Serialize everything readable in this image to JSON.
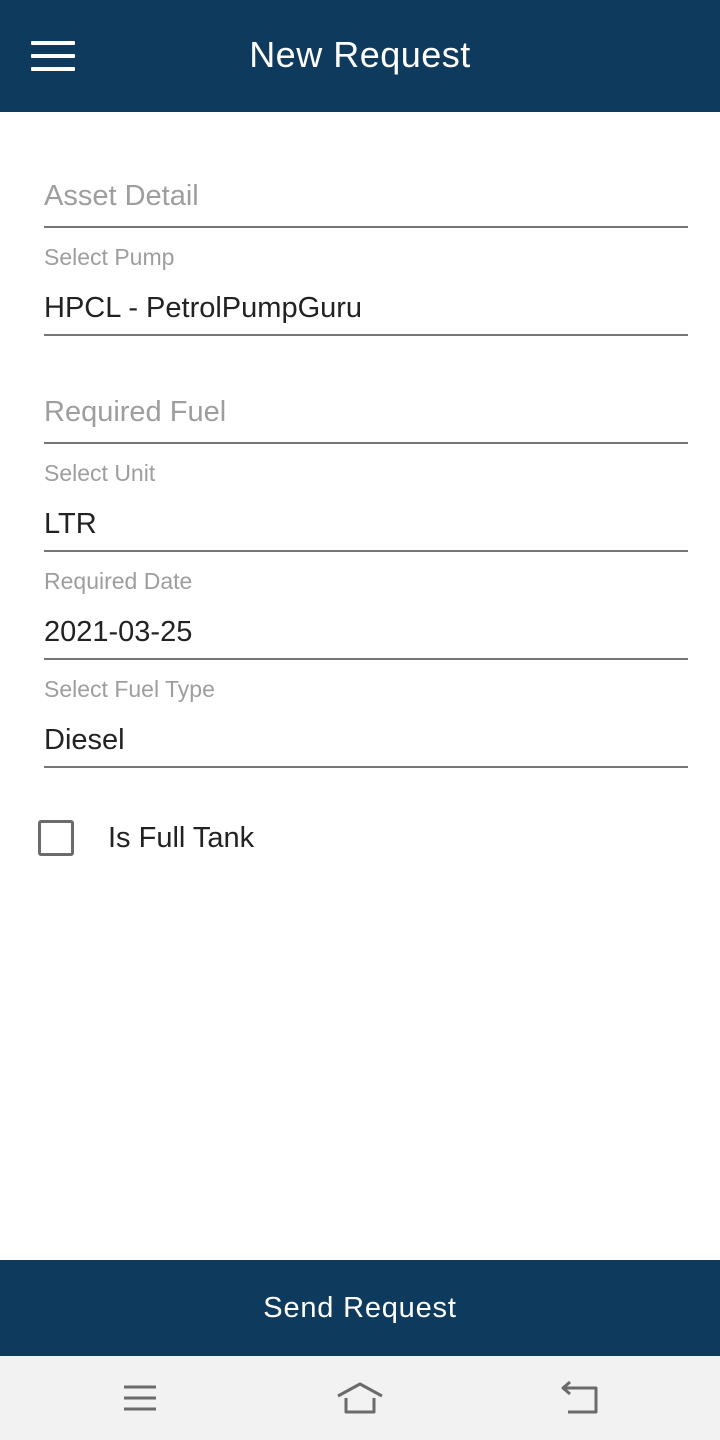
{
  "app_bar": {
    "title": "New Request",
    "menu_icon": "hamburger-menu-icon",
    "background": "#0e3a5e"
  },
  "form": {
    "asset_detail": {
      "placeholder": "Asset Detail",
      "value": ""
    },
    "pump": {
      "label": "Select Pump",
      "value": "HPCL - PetrolPumpGuru"
    },
    "required_fuel": {
      "placeholder": "Required Fuel",
      "value": ""
    },
    "unit": {
      "label": "Select Unit",
      "value": "LTR"
    },
    "required_date": {
      "label": "Required Date",
      "value": "2021-03-25"
    },
    "fuel_type": {
      "label": "Select Fuel Type",
      "value": "Diesel"
    },
    "full_tank": {
      "label": "Is Full Tank",
      "checked": false
    }
  },
  "send_button": {
    "label": "Send Request"
  },
  "system_nav": {
    "icons": [
      "recents-icon",
      "home-icon",
      "back-icon"
    ]
  }
}
